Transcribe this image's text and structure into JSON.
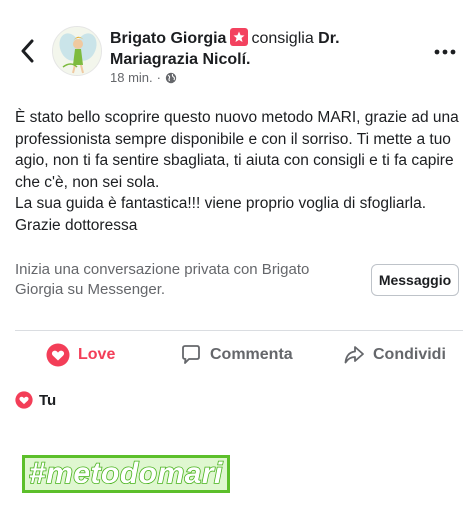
{
  "colors": {
    "love_red": "#f33e58",
    "hashtag_green": "#5cbf2a",
    "secondary_text": "#65676b"
  },
  "header": {
    "author": "Brigato Giorgia",
    "recommend_icon": "star-recommend-icon",
    "verb": "consiglia",
    "page_name": "Dr. Mariagrazia Nicolí.",
    "timestamp": "18 min.",
    "separator": "·",
    "privacy_icon": "globe-icon"
  },
  "post": {
    "text": "È stato bello scoprire questo nuovo metodo MARI, grazie ad una professionista sempre disponibile e con il sorriso. Ti mette a tuo agio, non ti fa sentire sbagliata, ti aiuta con consigli e ti fa capire che c'è, non sei sola.\nLa sua guida è fantastica!!! viene proprio voglia di sfogliarla.\nGrazie dottoressa"
  },
  "messenger": {
    "prompt": "Inizia una conversazione privata con Brigato Giorgia su Messenger.",
    "button_label": "Messaggio"
  },
  "actions": {
    "love": "Love",
    "comment": "Commenta",
    "share": "Condividi"
  },
  "reactions": {
    "who": "Tu"
  },
  "overlay": {
    "hashtag": "#metodomari"
  }
}
